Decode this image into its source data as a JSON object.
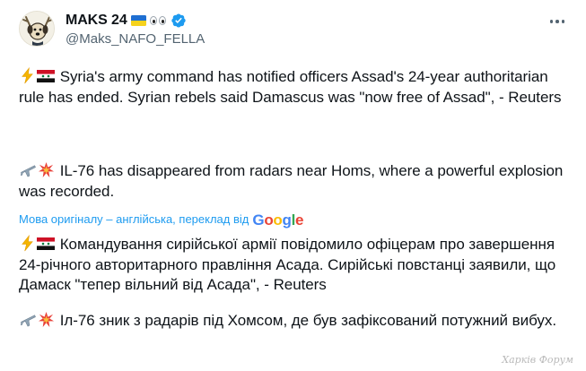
{
  "author": {
    "display_name": "MAKS 24",
    "handle": "@Maks_NAFO_FELLA"
  },
  "icons": {
    "avatar": "nafo-dog-avatar",
    "flag": "ukraine-flag-emoji",
    "eyes": "eyes-emoji",
    "verified": "verified-badge-icon",
    "more": "more-options-icon",
    "zap": "lightning-emoji",
    "syria_flag": "syria-flag-emoji",
    "plane": "airplane-emoji",
    "collision": "collision-emoji"
  },
  "colors": {
    "verified_blue": "#1d9bf0",
    "link_blue": "#1d9bf0",
    "secondary_text": "#536471"
  },
  "post": {
    "original": [
      "Syria's army command has notified officers Assad's 24-year authoritarian rule has ended. Syrian rebels said Damascus was \"now free of Assad\", - Reuters",
      "IL-76 has disappeared from radars near Homs, where a powerful explosion was recorded."
    ],
    "translation_label": "Мова оригіналу – англійська, переклад від",
    "translation_provider": "Google",
    "translated": [
      "Командування сирійської армії повідомило офіцерам про завершення 24-річного авторитарного правління Асада. Сирійські повстанці заявили, що Дамаск \"тепер вільний від Асада\", - Reuters",
      "Іл-76 зник з радарів під Хомсом, де був зафіксований потужний вибух."
    ]
  },
  "watermark": "Харків Форум"
}
